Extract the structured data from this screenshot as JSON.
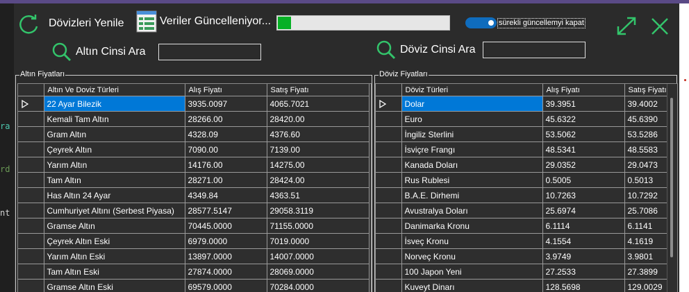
{
  "editor_fragments": [
    "ra",
    "rd",
    "nt"
  ],
  "toolbar": {
    "refresh_label": "Dövizleri Yenile",
    "status_label": "Veriler Güncelleniyor...",
    "progress": 0.075,
    "auto_update_label": "sürekli güncellemyi kapat",
    "gold_search_label": "Altın Cinsi Ara",
    "gold_search_value": "",
    "currency_search_label": "Döviz Cinsi Ara",
    "currency_search_value": ""
  },
  "gold": {
    "group_title": "Altın Fiyatları",
    "columns": [
      "Altın Ve Doviz     Türleri",
      "Alış Fiyatı",
      "Satış Fiyatı"
    ],
    "rows": [
      [
        "22 Ayar Bilezik",
        "3935.0097",
        "4065.7021"
      ],
      [
        "Kemali Tam Altın",
        "28266.00",
        "28420.00"
      ],
      [
        "Gram Altın",
        "4328.09",
        "4376.60"
      ],
      [
        "Çeyrek Altın",
        "7090.00",
        "7139.00"
      ],
      [
        "Yarım Altın",
        "14176.00",
        "14275.00"
      ],
      [
        "Tam Altın",
        "28271.00",
        "28424.00"
      ],
      [
        "Has Altın 24 Ayar",
        "4349.84",
        "4363.51"
      ],
      [
        "Cumhuriyet Altını (Serbest Piyasa)",
        "28577.5147",
        "29058.3119"
      ],
      [
        "Gramse Altın",
        "70445.0000",
        "71155.0000"
      ],
      [
        "Çeyrek Altın Eski",
        "6979.0000",
        "7019.0000"
      ],
      [
        "Yarım Altın Eski",
        "13897.0000",
        "14007.0000"
      ],
      [
        "Tam Altın Eski",
        "27874.0000",
        "28069.0000"
      ],
      [
        "Gramse Altın Eski",
        "69579.0000",
        "70284.0000"
      ]
    ]
  },
  "currency": {
    "group_title": "Döviz Fiyatları",
    "columns": [
      "Döviz  Türleri",
      "Alış Fiyatı",
      "Satış Fiyatı"
    ],
    "rows": [
      [
        "Dolar",
        "39.3951",
        "39.4002"
      ],
      [
        "Euro",
        "45.6322",
        "45.6390"
      ],
      [
        "İngiliz Sterlini",
        "53.5062",
        "53.5286"
      ],
      [
        "İsviçre Frangı",
        "48.5341",
        "48.5583"
      ],
      [
        "Kanada Doları",
        "29.0352",
        "29.0473"
      ],
      [
        "Rus Rublesi",
        "0.5005",
        "0.5013"
      ],
      [
        "B.A.E. Dirhemi",
        "10.7263",
        "10.7292"
      ],
      [
        "Avustralya Doları",
        "25.6974",
        "25.7086"
      ],
      [
        "Danimarka Kronu",
        "6.1114",
        "6.1141"
      ],
      [
        "İsveç Kronu",
        "4.1554",
        "4.1619"
      ],
      [
        "Norveç Kronu",
        "3.9749",
        "3.9801"
      ],
      [
        "100 Japon Yeni",
        "27.2533",
        "27.3899"
      ],
      [
        "Kuveyt Dinarı",
        "128.5698",
        "129.0029"
      ]
    ]
  },
  "icons": {
    "refresh": "refresh-icon",
    "status": "form-list-icon",
    "search": "search-icon",
    "maximize": "maximize-icon",
    "close": "close-icon"
  },
  "colors": {
    "accent_green": "#33c46b",
    "selection_blue": "#0078d7",
    "progress_green": "#06b025",
    "background": "#2b2b2b"
  }
}
